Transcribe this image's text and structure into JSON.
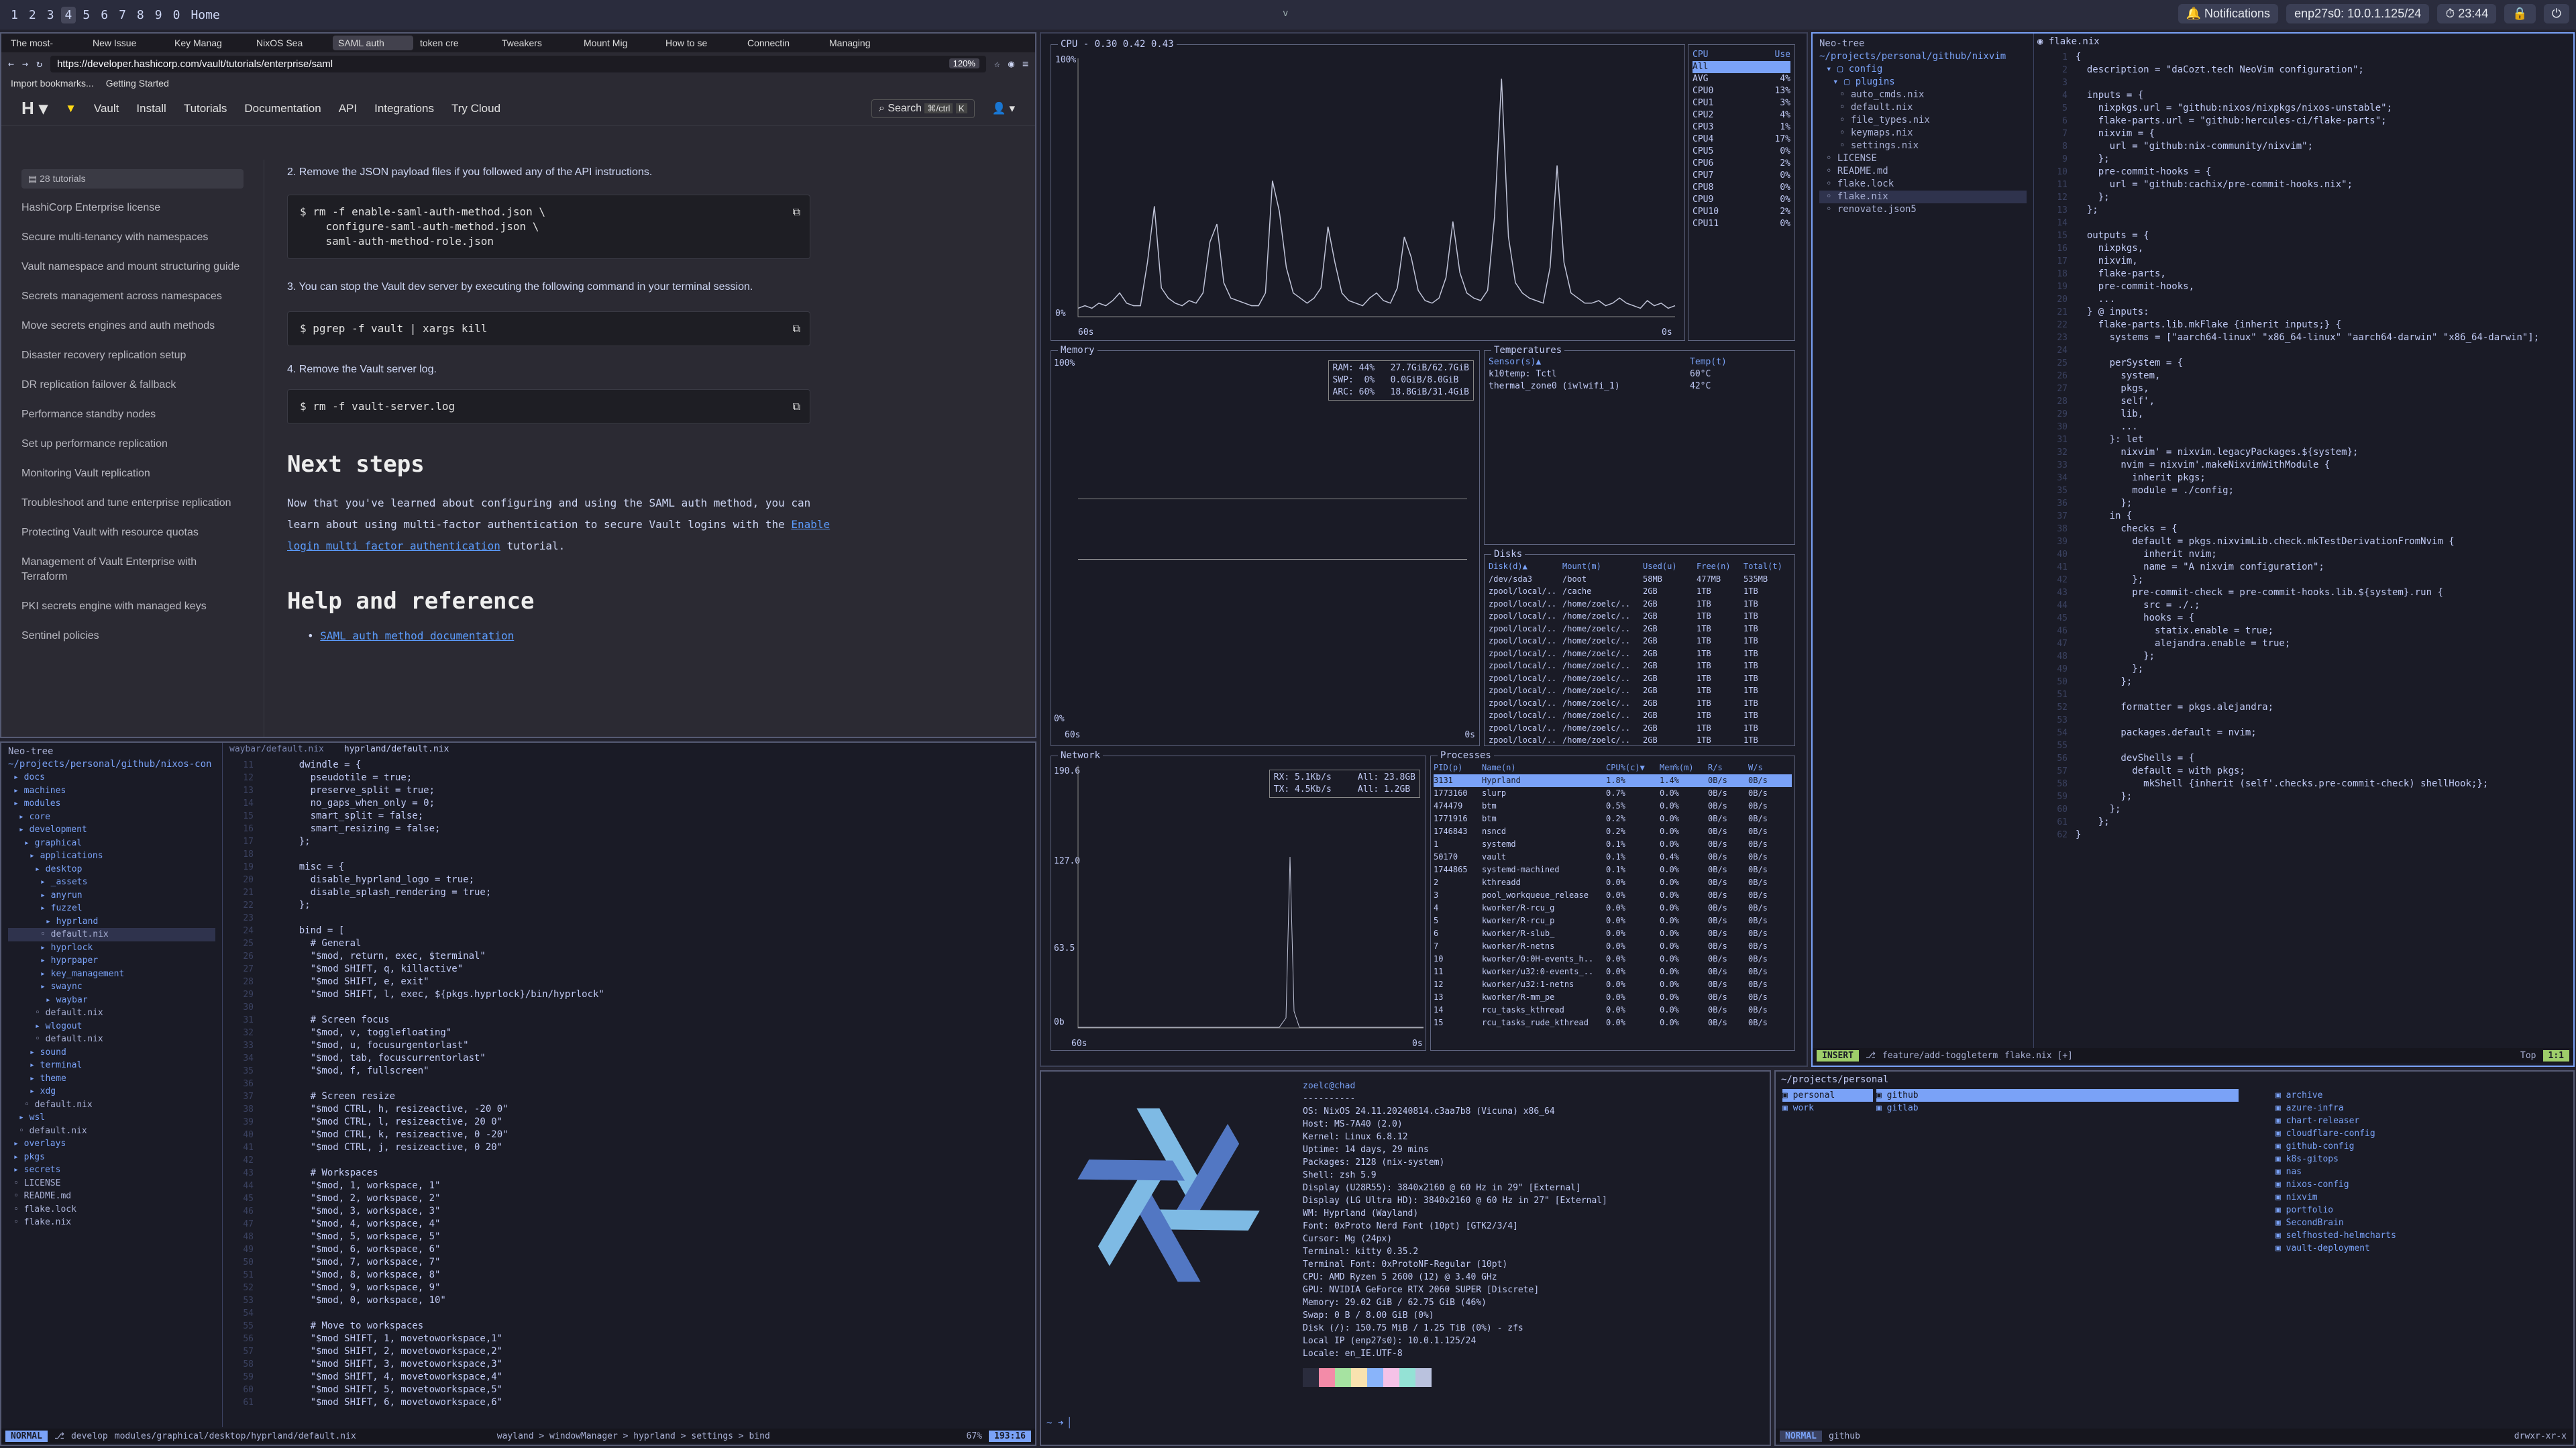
{
  "topbar": {
    "workspaces": [
      "1",
      "2",
      "3",
      "4",
      "5",
      "6",
      "7",
      "8",
      "9",
      "0",
      "Home"
    ],
    "center_glyph": "v",
    "notifications_label": "Notifications",
    "network_label": "enp27s0: 10.0.1.125/24",
    "time": "23:44"
  },
  "browser": {
    "tabs": [
      "The most-",
      "New Issue",
      "Key Manag",
      "NixOS Sea",
      "SAML auth",
      "token cre",
      "Tweakers",
      "Mount Mig",
      "How to se",
      "Connectin",
      "Managing"
    ],
    "url": "https://developer.hashicorp.com/vault/tutorials/enterprise/saml",
    "zoom": "120%",
    "bookmarks": [
      "Import bookmarks...",
      "Getting Started"
    ],
    "nav": {
      "product": "Vault",
      "items": [
        "Install",
        "Tutorials",
        "Documentation",
        "API",
        "Integrations",
        "Try Cloud"
      ],
      "search_label": "Search",
      "search_shortcut": "⌘/ctrl",
      "search_key": "K"
    },
    "sidebar": {
      "count": "28 tutorials",
      "items": [
        "HashiCorp Enterprise license",
        "Secure multi-tenancy with namespaces",
        "Vault namespace and mount structuring guide",
        "Secrets management across namespaces",
        "Move secrets engines and auth methods",
        "Disaster recovery replication setup",
        "DR replication failover & fallback",
        "Performance standby nodes",
        "Set up performance replication",
        "Monitoring Vault replication",
        "Troubleshoot and tune enterprise replication",
        "Protecting Vault with resource quotas",
        "Management of Vault Enterprise with Terraform",
        "PKI secrets engine with managed keys",
        "Sentinel policies"
      ]
    },
    "content": {
      "step2": "2. Remove the JSON payload files if you followed any of the API instructions.",
      "code2": [
        "$ rm -f enable-saml-auth-method.json \\",
        "    configure-saml-auth-method.json \\",
        "    saml-auth-method-role.json"
      ],
      "step3": "3. You can stop the Vault dev server by executing the following command in your terminal session.",
      "code3": "$ pgrep -f vault | xargs kill",
      "step4": "4. Remove the Vault server log.",
      "code4": "$ rm -f vault-server.log",
      "next_heading": "Next steps",
      "next_text_before": "Now that you've learned about configuring and using the SAML auth method, you can learn about using multi-factor authentication to secure Vault logins with the ",
      "next_link": "Enable login multi factor authentication",
      "next_text_after": " tutorial.",
      "help_heading": "Help and reference",
      "help_link": "SAML auth method documentation"
    }
  },
  "monitor": {
    "cpu": {
      "title": "CPU - 0.30 0.42 0.43",
      "y_top": "100%",
      "y_bottom": "0%",
      "x_left": "60s",
      "x_right": "0s",
      "table_header": [
        "CPU",
        "Use"
      ],
      "rows": [
        [
          "All",
          ""
        ],
        [
          "AVG",
          "4%"
        ],
        [
          "CPU0",
          "13%"
        ],
        [
          "CPU1",
          "3%"
        ],
        [
          "CPU2",
          "4%"
        ],
        [
          "CPU3",
          "1%"
        ],
        [
          "CPU4",
          "17%"
        ],
        [
          "CPU5",
          "0%"
        ],
        [
          "CPU6",
          "2%"
        ],
        [
          "CPU7",
          "0%"
        ],
        [
          "CPU8",
          "0%"
        ],
        [
          "CPU9",
          "0%"
        ],
        [
          "CPU10",
          "2%"
        ],
        [
          "CPU11",
          "0%"
        ]
      ],
      "series": [
        2,
        3,
        2,
        4,
        3,
        5,
        8,
        4,
        3,
        3,
        20,
        42,
        10,
        6,
        4,
        3,
        5,
        4,
        8,
        28,
        35,
        12,
        6,
        5,
        4,
        3,
        3,
        8,
        52,
        40,
        18,
        8,
        6,
        4,
        6,
        10,
        34,
        20,
        8,
        5,
        4,
        3,
        6,
        8,
        5,
        4,
        10,
        30,
        22,
        9,
        5,
        4,
        6,
        14,
        36,
        16,
        8,
        6,
        5,
        9,
        38,
        92,
        30,
        12,
        8,
        6,
        5,
        4,
        18,
        58,
        20,
        8,
        6,
        4,
        4,
        5,
        3,
        4,
        6,
        4,
        3,
        2,
        5,
        3,
        4,
        2,
        3
      ]
    },
    "memory": {
      "title": "Memory",
      "y_top": "100%",
      "y_bottom": "0%",
      "x_left": "60s",
      "x_right": "0s",
      "legend": [
        "RAM: 44%   27.7GiB/62.7GiB",
        "SWP:  0%   0.0GiB/8.0GiB",
        "ARC: 60%   18.8GiB/31.4GiB"
      ]
    },
    "temps": {
      "title": "Temperatures",
      "header": [
        "Sensor(s)▲",
        "Temp(t)"
      ],
      "rows": [
        [
          "k10temp: Tctl",
          "60°C"
        ],
        [
          "thermal_zone0 (iwlwifi_1)",
          "42°C"
        ]
      ]
    },
    "disks": {
      "title": "Disks",
      "header": [
        "Disk(d)▲",
        "Mount(m)",
        "Used(u)",
        "Free(n)",
        "Total(t)"
      ],
      "rows": [
        [
          "/dev/sda3",
          "/boot",
          "58MB",
          "477MB",
          "535MB"
        ],
        [
          "zpool/local/..",
          "/cache",
          "2GB",
          "1TB",
          "1TB"
        ],
        [
          "zpool/local/..",
          "/home/zoelc/..",
          "2GB",
          "1TB",
          "1TB"
        ],
        [
          "zpool/local/..",
          "/home/zoelc/..",
          "2GB",
          "1TB",
          "1TB"
        ],
        [
          "zpool/local/..",
          "/home/zoelc/..",
          "2GB",
          "1TB",
          "1TB"
        ],
        [
          "zpool/local/..",
          "/home/zoelc/..",
          "2GB",
          "1TB",
          "1TB"
        ],
        [
          "zpool/local/..",
          "/home/zoelc/..",
          "2GB",
          "1TB",
          "1TB"
        ],
        [
          "zpool/local/..",
          "/home/zoelc/..",
          "2GB",
          "1TB",
          "1TB"
        ],
        [
          "zpool/local/..",
          "/home/zoelc/..",
          "2GB",
          "1TB",
          "1TB"
        ],
        [
          "zpool/local/..",
          "/home/zoelc/..",
          "2GB",
          "1TB",
          "1TB"
        ],
        [
          "zpool/local/..",
          "/home/zoelc/..",
          "2GB",
          "1TB",
          "1TB"
        ],
        [
          "zpool/local/..",
          "/home/zoelc/..",
          "2GB",
          "1TB",
          "1TB"
        ],
        [
          "zpool/local/..",
          "/home/zoelc/..",
          "2GB",
          "1TB",
          "1TB"
        ],
        [
          "zpool/local/..",
          "/home/zoelc/..",
          "2GB",
          "1TB",
          "1TB"
        ]
      ]
    },
    "network": {
      "title": "Network",
      "y_top": "190.6",
      "y_mid": "127.0",
      "y_low": "63.5",
      "y_bottom": "0b",
      "x_left": "60s",
      "x_right": "0s",
      "legend": [
        "RX: 5.1Kb/s     All: 23.8GB",
        "TX: 4.5Kb/s     All: 1.2GB"
      ]
    },
    "processes": {
      "title": "Processes",
      "header": [
        "PID(p)",
        "Name(n)",
        "CPU%(c)▼",
        "Mem%(m)",
        "R/s",
        "W/s"
      ],
      "rows": [
        [
          "3131",
          "Hyprland",
          "1.8%",
          "1.4%",
          "0B/s",
          "0B/s"
        ],
        [
          "1773160",
          "slurp",
          "0.7%",
          "0.0%",
          "0B/s",
          "0B/s"
        ],
        [
          "474479",
          "btm",
          "0.5%",
          "0.0%",
          "0B/s",
          "0B/s"
        ],
        [
          "1771916",
          "btm",
          "0.2%",
          "0.0%",
          "0B/s",
          "0B/s"
        ],
        [
          "1746843",
          "nsncd",
          "0.2%",
          "0.0%",
          "0B/s",
          "0B/s"
        ],
        [
          "1",
          "systemd",
          "0.1%",
          "0.0%",
          "0B/s",
          "0B/s"
        ],
        [
          "50170",
          "vault",
          "0.1%",
          "0.4%",
          "0B/s",
          "0B/s"
        ],
        [
          "1744865",
          "systemd-machined",
          "0.1%",
          "0.0%",
          "0B/s",
          "0B/s"
        ],
        [
          "2",
          "kthreadd",
          "0.0%",
          "0.0%",
          "0B/s",
          "0B/s"
        ],
        [
          "3",
          "pool_workqueue_release",
          "0.0%",
          "0.0%",
          "0B/s",
          "0B/s"
        ],
        [
          "4",
          "kworker/R-rcu_g",
          "0.0%",
          "0.0%",
          "0B/s",
          "0B/s"
        ],
        [
          "5",
          "kworker/R-rcu_p",
          "0.0%",
          "0.0%",
          "0B/s",
          "0B/s"
        ],
        [
          "6",
          "kworker/R-slub_",
          "0.0%",
          "0.0%",
          "0B/s",
          "0B/s"
        ],
        [
          "7",
          "kworker/R-netns",
          "0.0%",
          "0.0%",
          "0B/s",
          "0B/s"
        ],
        [
          "10",
          "kworker/0:0H-events_h..",
          "0.0%",
          "0.0%",
          "0B/s",
          "0B/s"
        ],
        [
          "11",
          "kworker/u32:0-events_..",
          "0.0%",
          "0.0%",
          "0B/s",
          "0B/s"
        ],
        [
          "12",
          "kworker/u32:1-netns",
          "0.0%",
          "0.0%",
          "0B/s",
          "0B/s"
        ],
        [
          "13",
          "kworker/R-mm_pe",
          "0.0%",
          "0.0%",
          "0B/s",
          "0B/s"
        ],
        [
          "14",
          "rcu_tasks_kthread",
          "0.0%",
          "0.0%",
          "0B/s",
          "0B/s"
        ],
        [
          "15",
          "rcu_tasks_rude_kthread",
          "0.0%",
          "0.0%",
          "0B/s",
          "0B/s"
        ]
      ]
    }
  },
  "nvim_right": {
    "tree_title": "Neo-tree",
    "tree_path": "~/projects/personal/github/nixvim",
    "tree": [
      "config",
      "plugins",
      "auto_cmds.nix",
      "default.nix",
      "file_types.nix",
      "keymaps.nix",
      "settings.nix",
      "LICENSE",
      "README.md",
      "flake.lock",
      "flake.nix",
      "renovate.json5"
    ],
    "file_tab": "flake.nix",
    "code": [
      "{",
      "  description = \"daCozt.tech NeoVim configuration\";",
      "",
      "  inputs = {",
      "    nixpkgs.url = \"github:nixos/nixpkgs/nixos-unstable\";",
      "    flake-parts.url = \"github:hercules-ci/flake-parts\";",
      "    nixvim = {",
      "      url = \"github:nix-community/nixvim\";",
      "    };",
      "    pre-commit-hooks = {",
      "      url = \"github:cachix/pre-commit-hooks.nix\";",
      "    };",
      "  };",
      "",
      "  outputs = {",
      "    nixpkgs,",
      "    nixvim,",
      "    flake-parts,",
      "    pre-commit-hooks,",
      "    ...",
      "  } @ inputs:",
      "    flake-parts.lib.mkFlake {inherit inputs;} {",
      "      systems = [\"aarch64-linux\" \"x86_64-linux\" \"aarch64-darwin\" \"x86_64-darwin\"];",
      "",
      "      perSystem = {",
      "        system,",
      "        pkgs,",
      "        self',",
      "        lib,",
      "        ...",
      "      }: let",
      "        nixvim' = nixvim.legacyPackages.${system};",
      "        nvim = nixvim'.makeNixvimWithModule {",
      "          inherit pkgs;",
      "          module = ./config;",
      "        };",
      "      in {",
      "        checks = {",
      "          default = pkgs.nixvimLib.check.mkTestDerivationFromNvim {",
      "            inherit nvim;",
      "            name = \"A nixvim configuration\";",
      "          };",
      "          pre-commit-check = pre-commit-hooks.lib.${system}.run {",
      "            src = ./.;",
      "            hooks = {",
      "              statix.enable = true;",
      "              alejandra.enable = true;",
      "            };",
      "          };",
      "        };",
      "",
      "        formatter = pkgs.alejandra;",
      "",
      "        packages.default = nvim;",
      "",
      "        devShells = {",
      "          default = with pkgs;",
      "            mkShell {inherit (self'.checks.pre-commit-check) shellHook;};",
      "        };",
      "      };",
      "    };",
      "}"
    ],
    "status": {
      "mode": "INSERT",
      "branch": "feature/add-toggleterm",
      "file": "flake.nix [+]",
      "pos": "Top",
      "line": "1:1"
    }
  },
  "nvim_left": {
    "tree_title": "Neo-tree",
    "tree_path": "~/projects/personal/github/nixos-con",
    "tree": [
      "docs",
      "machines",
      "modules",
      "core",
      "development",
      "graphical",
      "applications",
      "desktop",
      "_assets",
      "anyrun",
      "fuzzel",
      "hyprland",
      "default.nix",
      "hyprlock",
      "hyprpaper",
      "key_management",
      "swaync",
      "waybar",
      "default.nix",
      "wlogout",
      "default.nix",
      "sound",
      "terminal",
      "theme",
      "xdg",
      "default.nix",
      "wsl",
      "default.nix",
      "overlays",
      "pkgs",
      "secrets",
      "LICENSE",
      "README.md",
      "flake.lock",
      "flake.nix"
    ],
    "tabs": [
      "waybar/default.nix",
      "hyprland/default.nix"
    ],
    "code": [
      "    dwindle = {",
      "      pseudotile = true;",
      "      preserve_split = true;",
      "      no_gaps_when_only = 0;",
      "      smart_split = false;",
      "      smart_resizing = false;",
      "    };",
      "",
      "    misc = {",
      "      disable_hyprland_logo = true;",
      "      disable_splash_rendering = true;",
      "    };",
      "",
      "    bind = [",
      "      # General",
      "      \"$mod, return, exec, $terminal\"",
      "      \"$mod SHIFT, q, killactive\"",
      "      \"$mod SHIFT, e, exit\"",
      "      \"$mod SHIFT, l, exec, ${pkgs.hyprlock}/bin/hyprlock\"",
      "",
      "      # Screen focus",
      "      \"$mod, v, togglefloating\"",
      "      \"$mod, u, focusurgentorlast\"",
      "      \"$mod, tab, focuscurrentorlast\"",
      "      \"$mod, f, fullscreen\"",
      "",
      "      # Screen resize",
      "      \"$mod CTRL, h, resizeactive, -20 0\"",
      "      \"$mod CTRL, l, resizeactive, 20 0\"",
      "      \"$mod CTRL, k, resizeactive, 0 -20\"",
      "      \"$mod CTRL, j, resizeactive, 0 20\"",
      "",
      "      # Workspaces",
      "      \"$mod, 1, workspace, 1\"",
      "      \"$mod, 2, workspace, 2\"",
      "      \"$mod, 3, workspace, 3\"",
      "      \"$mod, 4, workspace, 4\"",
      "      \"$mod, 5, workspace, 5\"",
      "      \"$mod, 6, workspace, 6\"",
      "      \"$mod, 7, workspace, 7\"",
      "      \"$mod, 8, workspace, 8\"",
      "      \"$mod, 9, workspace, 9\"",
      "      \"$mod, 0, workspace, 10\"",
      "",
      "      # Move to workspaces",
      "      \"$mod SHIFT, 1, movetoworkspace,1\"",
      "      \"$mod SHIFT, 2, movetoworkspace,2\"",
      "      \"$mod SHIFT, 3, movetoworkspace,3\"",
      "      \"$mod SHIFT, 4, movetoworkspace,4\"",
      "      \"$mod SHIFT, 5, movetoworkspace,5\"",
      "      \"$mod SHIFT, 6, movetoworkspace,6\""
    ],
    "status": {
      "mode": "NORMAL",
      "branch": "develop",
      "file": "modules/graphical/desktop/hyprland/default.nix",
      "crumbs": "wayland > windowManager > hyprland > settings > bind",
      "pct": "67%",
      "pos": "193:16"
    }
  },
  "fetch": {
    "user": "zoelc@chad",
    "sep": "----------",
    "lines": [
      "OS: NixOS 24.11.20240814.c3aa7b8 (Vicuna) x86_64",
      "Host: MS-7A40 (2.0)",
      "Kernel: Linux 6.8.12",
      "Uptime: 14 days, 29 mins",
      "Packages: 2128 (nix-system)",
      "Shell: zsh 5.9",
      "Display (U28R55): 3840x2160 @ 60 Hz in 29\" [External]",
      "Display (LG Ultra HD): 3840x2160 @ 60 Hz in 27\" [External]",
      "WM: Hyprland (Wayland)",
      "Font: 0xProto Nerd Font (10pt) [GTK2/3/4]",
      "Cursor: Mg (24px)",
      "Terminal: kitty 0.35.2",
      "Terminal Font: 0xProtoNF-Regular (10pt)",
      "CPU: AMD Ryzen 5 2600 (12) @ 3.40 GHz",
      "GPU: NVIDIA GeForce RTX 2060 SUPER [Discrete]",
      "Memory: 29.02 GiB / 62.75 GiB (46%)",
      "Swap: 0 B / 8.00 GiB (0%)",
      "Disk (/): 150.75 MiB / 1.25 TiB (0%) - zfs",
      "Local IP (enp27s0): 10.0.1.125/24",
      "Locale: en_IE.UTF-8"
    ],
    "swatches": [
      "#2a2c3d",
      "#f38ba8",
      "#a6e3a1",
      "#f9e2af",
      "#89b4fa",
      "#f5c2e7",
      "#94e2d5",
      "#bac2de"
    ],
    "prompt": "~ ➜"
  },
  "files": {
    "path": "~/projects/personal",
    "col1": [
      "personal",
      "work"
    ],
    "col2": [
      "github",
      "gitlab"
    ],
    "col3": [
      "archive",
      "azure-infra",
      "chart-releaser",
      "cloudflare-config",
      "github-config",
      "k8s-gitops",
      "nas",
      "nixos-config",
      "nixvim",
      "portfolio",
      "SecondBrain",
      "selfhosted-helmcharts",
      "vault-deployment"
    ],
    "status_left": "github",
    "status_right": "drwxr-xr-x"
  }
}
